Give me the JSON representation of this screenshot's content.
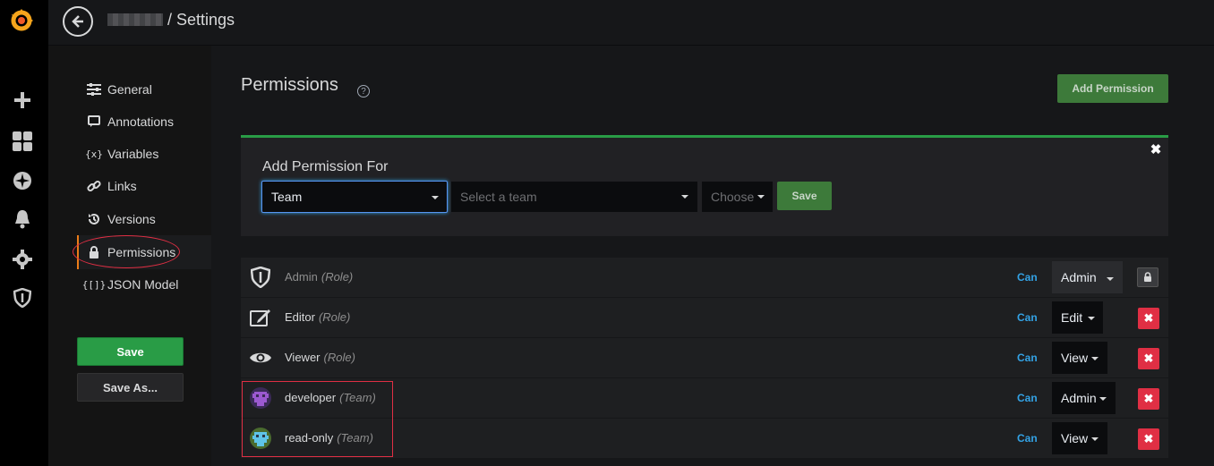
{
  "header": {
    "breadcrumb_separator_title": "/ Settings"
  },
  "sidebar": {
    "items": [
      {
        "label": "General",
        "icon": "sliders-icon"
      },
      {
        "label": "Annotations",
        "icon": "comment-icon"
      },
      {
        "label": "Variables",
        "icon": "variable-icon"
      },
      {
        "label": "Links",
        "icon": "link-icon"
      },
      {
        "label": "Versions",
        "icon": "history-icon"
      },
      {
        "label": "Permissions",
        "icon": "lock-icon",
        "active": true
      },
      {
        "label": "JSON Model",
        "icon": "brackets-icon"
      }
    ],
    "save_label": "Save",
    "save_as_label": "Save As..."
  },
  "main": {
    "title": "Permissions",
    "help_glyph": "?",
    "add_permission_label": "Add Permission",
    "panel": {
      "title": "Add Permission For",
      "type_value": "Team",
      "team_placeholder": "Select a team",
      "choose_placeholder": "Choose",
      "save_label": "Save"
    },
    "can_label": "Can",
    "rows": [
      {
        "name": "Admin",
        "kind": "(Role)",
        "permission": "Admin",
        "locked": true
      },
      {
        "name": "Editor",
        "kind": "(Role)",
        "permission": "Edit"
      },
      {
        "name": "Viewer",
        "kind": "(Role)",
        "permission": "View"
      },
      {
        "name": "developer",
        "kind": "(Team)",
        "permission": "Admin"
      },
      {
        "name": "read-only",
        "kind": "(Team)",
        "permission": "View"
      }
    ]
  },
  "colors": {
    "accent_green": "#299c46",
    "link_blue": "#33a2e5",
    "danger_red": "#e02f44",
    "active_orange": "#eb7b18"
  }
}
